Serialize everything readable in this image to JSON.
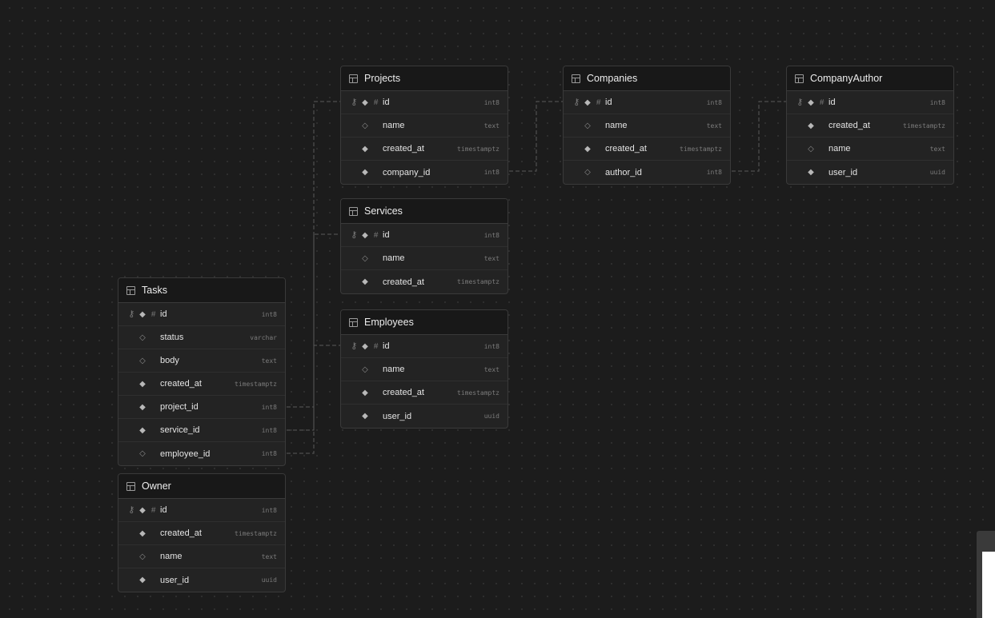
{
  "tables": {
    "projects": {
      "title": "Projects",
      "columns": [
        {
          "name": "id",
          "type": "int8",
          "primary_key": true,
          "nullable": false,
          "identity": true
        },
        {
          "name": "name",
          "type": "text",
          "primary_key": false,
          "nullable": true,
          "identity": false
        },
        {
          "name": "created_at",
          "type": "timestamptz",
          "primary_key": false,
          "nullable": false,
          "identity": false
        },
        {
          "name": "company_id",
          "type": "int8",
          "primary_key": false,
          "nullable": false,
          "identity": false
        }
      ]
    },
    "companies": {
      "title": "Companies",
      "columns": [
        {
          "name": "id",
          "type": "int8",
          "primary_key": true,
          "nullable": false,
          "identity": true
        },
        {
          "name": "name",
          "type": "text",
          "primary_key": false,
          "nullable": true,
          "identity": false
        },
        {
          "name": "created_at",
          "type": "timestamptz",
          "primary_key": false,
          "nullable": false,
          "identity": false
        },
        {
          "name": "author_id",
          "type": "int8",
          "primary_key": false,
          "nullable": true,
          "identity": false
        }
      ]
    },
    "company_author": {
      "title": "CompanyAuthor",
      "columns": [
        {
          "name": "id",
          "type": "int8",
          "primary_key": true,
          "nullable": false,
          "identity": true
        },
        {
          "name": "created_at",
          "type": "timestamptz",
          "primary_key": false,
          "nullable": false,
          "identity": false
        },
        {
          "name": "name",
          "type": "text",
          "primary_key": false,
          "nullable": true,
          "identity": false
        },
        {
          "name": "user_id",
          "type": "uuid",
          "primary_key": false,
          "nullable": false,
          "identity": false
        }
      ]
    },
    "services": {
      "title": "Services",
      "columns": [
        {
          "name": "id",
          "type": "int8",
          "primary_key": true,
          "nullable": false,
          "identity": true
        },
        {
          "name": "name",
          "type": "text",
          "primary_key": false,
          "nullable": true,
          "identity": false
        },
        {
          "name": "created_at",
          "type": "timestamptz",
          "primary_key": false,
          "nullable": false,
          "identity": false
        }
      ]
    },
    "employees": {
      "title": "Employees",
      "columns": [
        {
          "name": "id",
          "type": "int8",
          "primary_key": true,
          "nullable": false,
          "identity": true
        },
        {
          "name": "name",
          "type": "text",
          "primary_key": false,
          "nullable": true,
          "identity": false
        },
        {
          "name": "created_at",
          "type": "timestamptz",
          "primary_key": false,
          "nullable": false,
          "identity": false
        },
        {
          "name": "user_id",
          "type": "uuid",
          "primary_key": false,
          "nullable": false,
          "identity": false
        }
      ]
    },
    "tasks": {
      "title": "Tasks",
      "columns": [
        {
          "name": "id",
          "type": "int8",
          "primary_key": true,
          "nullable": false,
          "identity": true
        },
        {
          "name": "status",
          "type": "varchar",
          "primary_key": false,
          "nullable": true,
          "identity": false
        },
        {
          "name": "body",
          "type": "text",
          "primary_key": false,
          "nullable": true,
          "identity": false
        },
        {
          "name": "created_at",
          "type": "timestamptz",
          "primary_key": false,
          "nullable": false,
          "identity": false
        },
        {
          "name": "project_id",
          "type": "int8",
          "primary_key": false,
          "nullable": false,
          "identity": false
        },
        {
          "name": "service_id",
          "type": "int8",
          "primary_key": false,
          "nullable": false,
          "identity": false
        },
        {
          "name": "employee_id",
          "type": "int8",
          "primary_key": false,
          "nullable": true,
          "identity": false
        }
      ]
    },
    "owner": {
      "title": "Owner",
      "columns": [
        {
          "name": "id",
          "type": "int8",
          "primary_key": true,
          "nullable": false,
          "identity": true
        },
        {
          "name": "created_at",
          "type": "timestamptz",
          "primary_key": false,
          "nullable": false,
          "identity": false
        },
        {
          "name": "name",
          "type": "text",
          "primary_key": false,
          "nullable": true,
          "identity": false
        },
        {
          "name": "user_id",
          "type": "uuid",
          "primary_key": false,
          "nullable": false,
          "identity": false
        }
      ]
    }
  },
  "icons": {
    "table": "table-icon",
    "primary_key": "key-icon",
    "not_null": "filled-diamond-icon",
    "nullable": "hollow-diamond-icon",
    "identity": "hash-icon"
  },
  "colors": {
    "canvas": "#1c1c1c",
    "node_body": "#232323",
    "node_header": "#181818",
    "border": "#3a3a3a",
    "edge": "#5a5a5a"
  }
}
